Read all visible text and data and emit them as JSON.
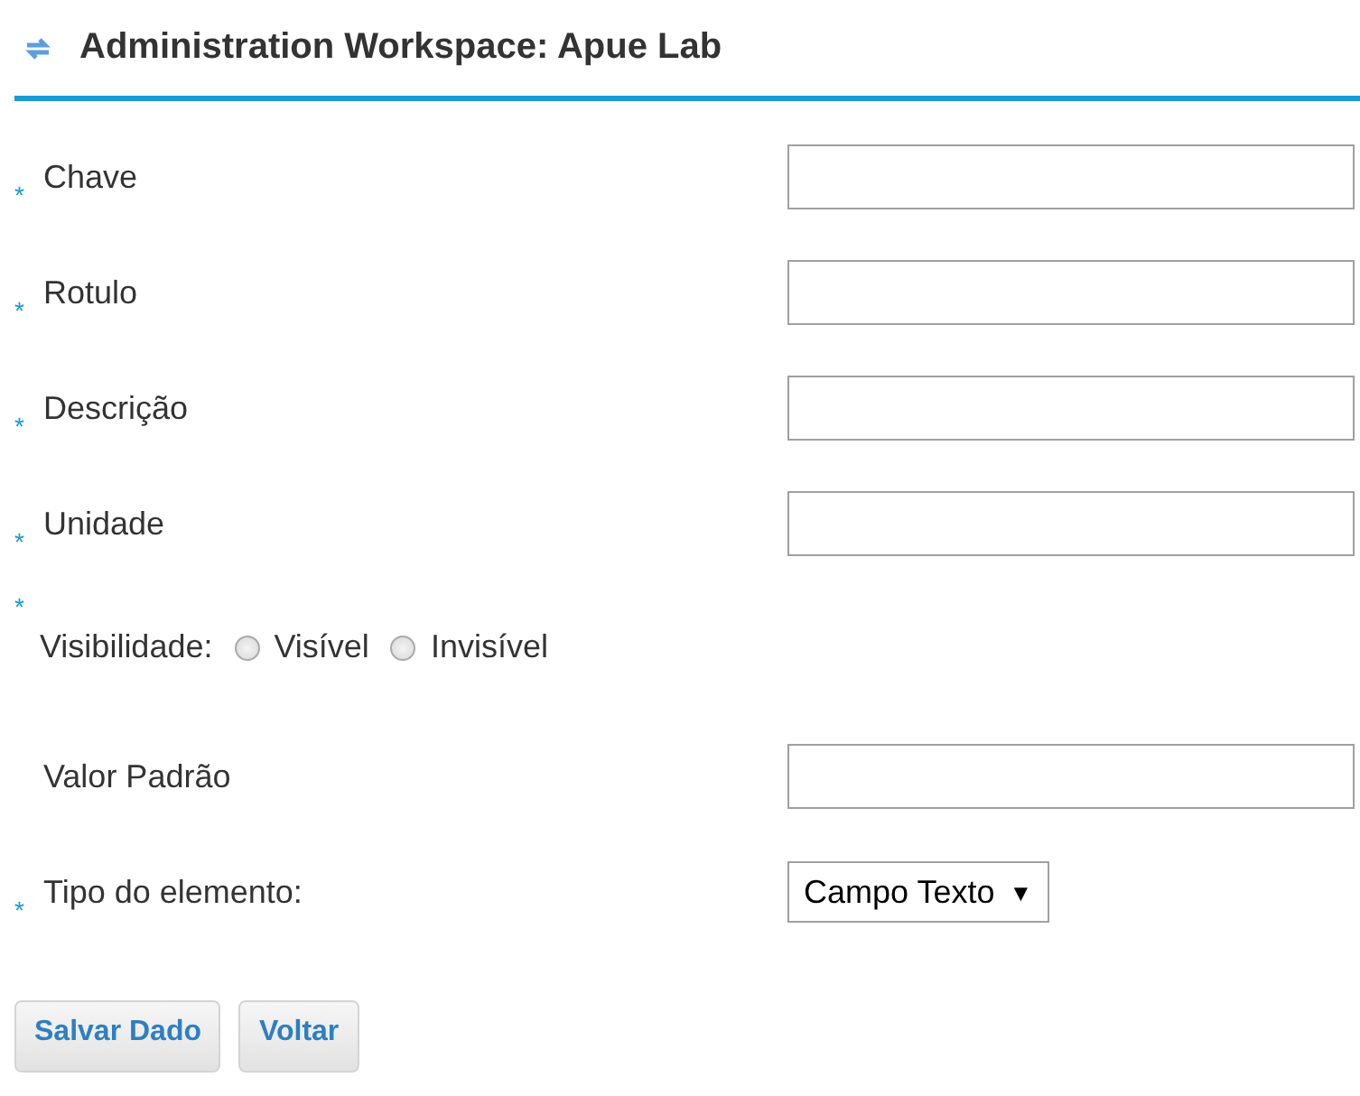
{
  "header": {
    "title": "Administration Workspace: Apue Lab"
  },
  "fields": [
    {
      "kind": "text",
      "mark": "*",
      "label": "Chave"
    },
    {
      "kind": "text",
      "mark": "*",
      "label": "Rotulo"
    },
    {
      "kind": "text",
      "mark": "*",
      "label": "Descrição"
    },
    {
      "kind": "text",
      "mark": "*",
      "label": "Unidade"
    },
    {
      "kind": "radio",
      "mark": "*",
      "label": "Visibilidade:",
      "options": [
        {
          "label": "Visível",
          "selected": false
        },
        {
          "label": "Invisível",
          "selected": false
        }
      ]
    },
    {
      "kind": "text",
      "label": "Valor Padrão"
    },
    {
      "kind": "select",
      "mark": "*",
      "label": "Tipo do elemento:",
      "value": "Campo Texto",
      "arrow": "▼"
    }
  ],
  "buttons": [
    "Salvar Dado",
    "Voltar"
  ]
}
